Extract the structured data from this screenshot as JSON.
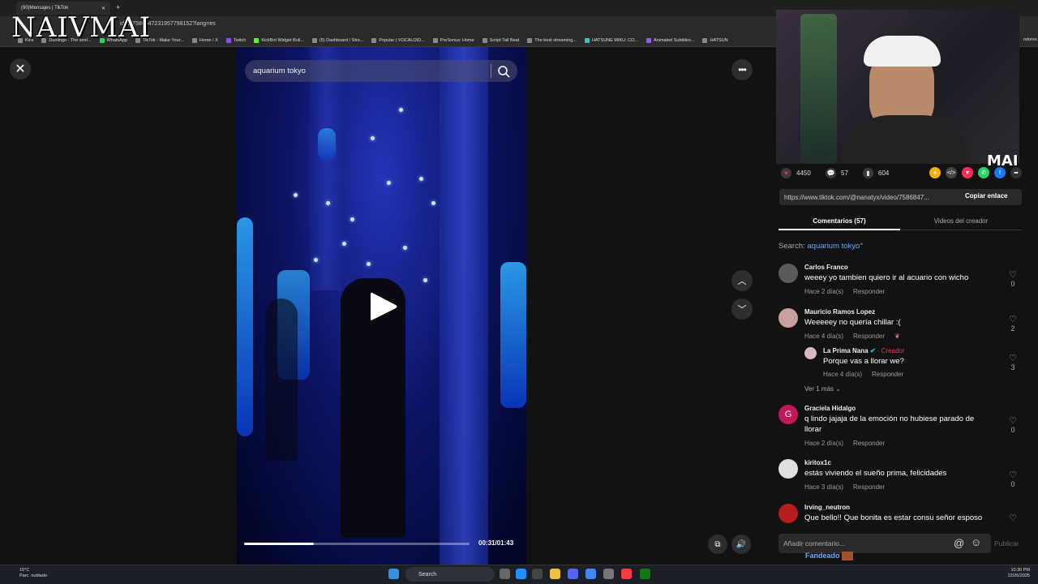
{
  "browser": {
    "tab_title": "(90)Mensajes | TikTok",
    "url": "ideo/7586847231957798152?lang=es",
    "bookmarks": [
      "Kick",
      "Duolingo - The worl...",
      "WhatsApp",
      "TikTok - Make Your...",
      "Home / X",
      "Twitch",
      "KickBot Widget Buil...",
      "(5) Dashboard / Stre...",
      "Popular | VOCALOID...",
      "PreSonus: Home",
      "Script Tail Beat",
      "The best streaming...",
      "HATSUNE MIKU: CO...",
      "Animated Subtitles...",
      "HATSUN"
    ],
    "bookmarks_right": "odores"
  },
  "overlay": {
    "watermark": "NAIVMAI",
    "webcam_tag": "MAI"
  },
  "video": {
    "search_query": "aquarium tokyo",
    "timecode": "00:31/01:43",
    "progress_fraction": 0.31
  },
  "stats": {
    "likes": "4450",
    "comments": "57",
    "saves": "604"
  },
  "link": {
    "url": "https://www.tiktok.com/@nanatyx/video/7586847...",
    "copy_label": "Copiar enlace"
  },
  "tabs": {
    "comments": "Comentarios (57)",
    "creator_videos": "Videos del creador"
  },
  "search_line": {
    "prefix": "Search:",
    "keyword": "aquarium tokyo"
  },
  "comments": [
    {
      "name": "Carlos Franco",
      "text": "weeey yo tambien quiero ir al acuario con wicho",
      "time": "Hace 2 día(s)",
      "reply": "Responder",
      "likes": "0",
      "avatar_color": "#5a5a5a"
    },
    {
      "name": "Mauricio Ramos Lopez",
      "text": "Weeeeey no quería chillar :(",
      "time": "Hace 4 día(s)",
      "reply": "Responder",
      "likes": "2",
      "avatar_color": "#c9a0a0"
    },
    {
      "name": "Graciela Hidalgo",
      "text": "q lindo jajaja de la emoción no hubiese parado de llorar",
      "time": "Hace 2 día(s)",
      "reply": "Responder",
      "likes": "0",
      "avatar_color": "#c2185b",
      "avatar_letter": "G"
    },
    {
      "name": "kiritox1c",
      "text": "estás viviendo el sueño prima, felicidades",
      "time": "Hace 3 día(s)",
      "reply": "Responder",
      "likes": "0",
      "avatar_color": "#e0e0e0"
    },
    {
      "name": "Irving_neutron",
      "text": "Que bello!! Que bonita es estar consu señor esposo",
      "avatar_color": "#b71c1c"
    }
  ],
  "reply": {
    "name": "La Prima Nana",
    "badge": "Creador",
    "text": "Porque vas a llorar we?",
    "time": "Hace 4 día(s)",
    "reply": "Responder",
    "likes": "3",
    "see_more": "Ver 1 más"
  },
  "add_comment": {
    "placeholder": "Añadir comentario...",
    "publish": "Publicar"
  },
  "fandeado": "Fandeado",
  "taskbar": {
    "weather_temp": "15°C",
    "weather_desc": "Parc. nublado",
    "search": "Search",
    "time": "10:30 PM",
    "date": "12/26/2025"
  },
  "colors": {
    "accent_red": "#fe2c55",
    "link_blue": "#6aa9ff",
    "like_red": "#e8315b"
  }
}
